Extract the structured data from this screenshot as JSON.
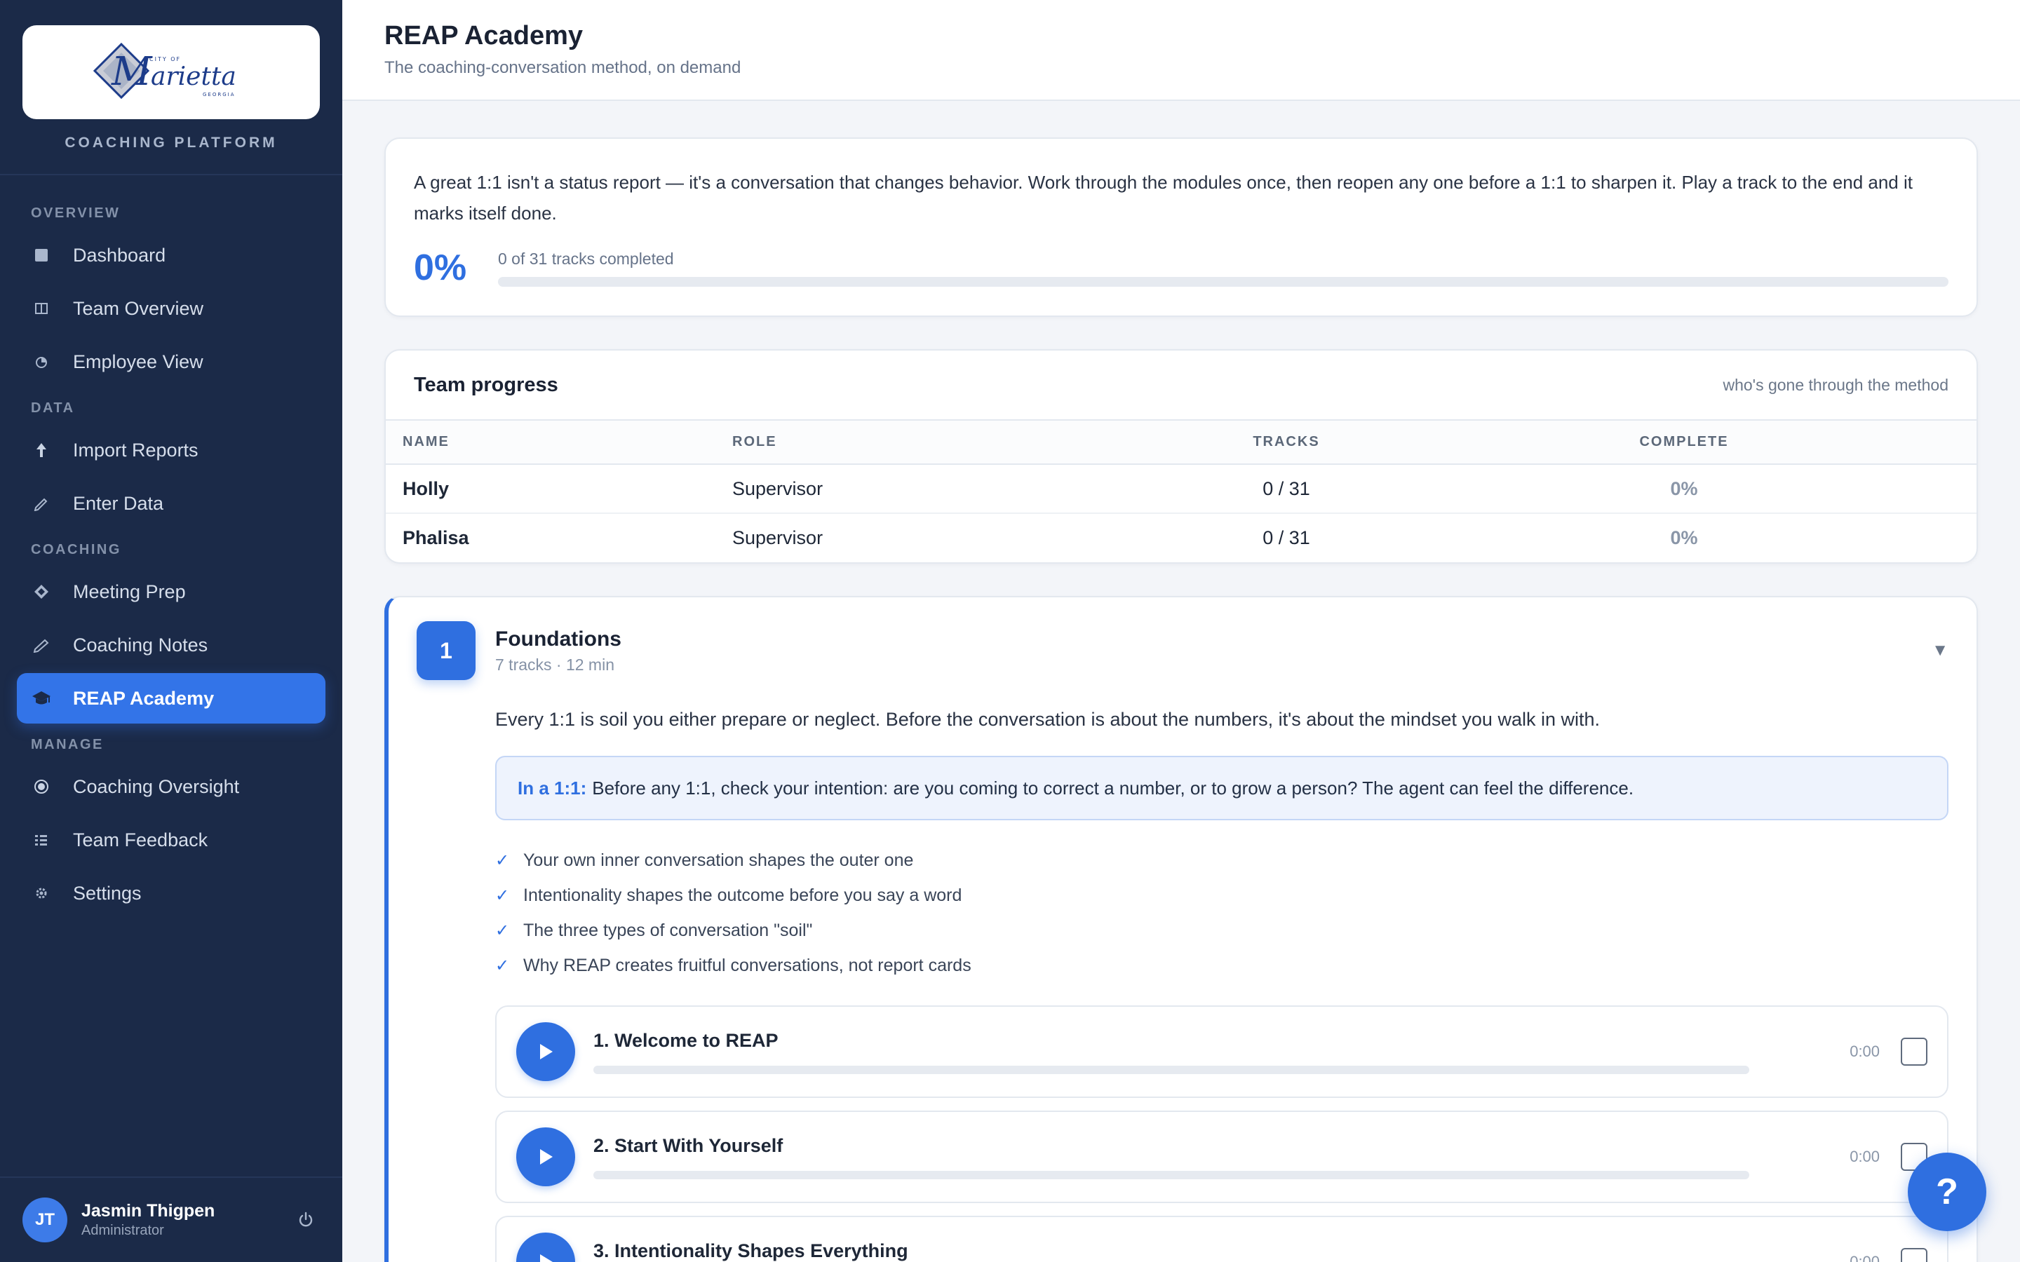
{
  "sidebar": {
    "platform_label": "COACHING PLATFORM",
    "sections": {
      "overview": "OVERVIEW",
      "data": "DATA",
      "coaching": "COACHING",
      "manage": "MANAGE"
    },
    "items": {
      "dashboard": {
        "label": "Dashboard",
        "icon": "square-icon"
      },
      "team_overview": {
        "label": "Team Overview",
        "icon": "columns-icon"
      },
      "employee_view": {
        "label": "Employee View",
        "icon": "pie-icon"
      },
      "import_reports": {
        "label": "Import Reports",
        "icon": "upload-arrow-icon"
      },
      "enter_data": {
        "label": "Enter Data",
        "icon": "pencil-icon"
      },
      "meeting_prep": {
        "label": "Meeting Prep",
        "icon": "diamond-icon"
      },
      "coaching_notes": {
        "label": "Coaching Notes",
        "icon": "pencil-icon"
      },
      "reap_academy": {
        "label": "REAP Academy",
        "icon": "graduation-cap-icon"
      },
      "coaching_oversight": {
        "label": "Coaching Oversight",
        "icon": "target-icon"
      },
      "team_feedback": {
        "label": "Team Feedback",
        "icon": "list-icon"
      },
      "settings": {
        "label": "Settings",
        "icon": "gear-icon"
      }
    },
    "user": {
      "initials": "JT",
      "name": "Jasmin Thigpen",
      "role": "Administrator"
    }
  },
  "header": {
    "title": "REAP Academy",
    "subtitle": "The coaching-conversation method, on demand"
  },
  "intro": {
    "text": "A great 1:1 isn't a status report — it's a conversation that changes behavior. Work through the modules once, then reopen any one before a 1:1 to sharpen it. Play a track to the end and it marks itself done.",
    "percent": "0%",
    "progress_value": 0,
    "caption": "0 of 31 tracks completed"
  },
  "team": {
    "title": "Team progress",
    "note": "who's gone through the method",
    "columns": {
      "name": "NAME",
      "role": "ROLE",
      "tracks": "TRACKS",
      "complete": "COMPLETE"
    },
    "rows": [
      {
        "name": "Holly",
        "role": "Supervisor",
        "tracks": "0 / 31",
        "complete": "0%"
      },
      {
        "name": "Phalisa",
        "role": "Supervisor",
        "tracks": "0 / 31",
        "complete": "0%"
      }
    ]
  },
  "module": {
    "number": "1",
    "title": "Foundations",
    "meta": "7 tracks · 12 min",
    "caret": "▼",
    "description": "Every 1:1 is soil you either prepare or neglect. Before the conversation is about the numbers, it's about the mindset you walk in with.",
    "callout_label": "In a 1:1:",
    "callout_text": "Before any 1:1, check your intention: are you coming to correct a number, or to grow a person? The agent can feel the difference.",
    "points": [
      "Your own inner conversation shapes the outer one",
      "Intentionality shapes the outcome before you say a word",
      "The three types of conversation \"soil\"",
      "Why REAP creates fruitful conversations, not report cards"
    ],
    "tracks": [
      {
        "title": "1. Welcome to REAP",
        "time": "0:00",
        "progress": 0
      },
      {
        "title": "2. Start With Yourself",
        "time": "0:00",
        "progress": 0
      },
      {
        "title": "3. Intentionality Shapes Everything",
        "time": "0:00",
        "progress": 0
      }
    ]
  },
  "help": {
    "label": "?"
  },
  "colors": {
    "accent": "#2f6fe0",
    "sidebar_bg": "#1b2a48",
    "active_nav": "#3374e8"
  }
}
